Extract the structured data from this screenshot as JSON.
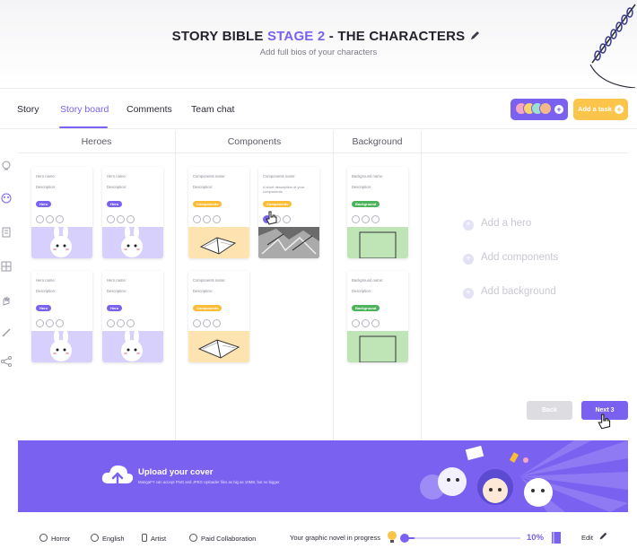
{
  "header": {
    "title_prefix": "STORY BIBLE ",
    "title_stage": "STAGE 2",
    "title_suffix": " - THE CHARACTERS",
    "subtitle": "Add full bios of your characters"
  },
  "tabs": [
    {
      "label": "Story"
    },
    {
      "label": "Story board",
      "active": true
    },
    {
      "label": "Comments"
    },
    {
      "label": "Team chat"
    }
  ],
  "actions": {
    "add_task": "Add a task"
  },
  "columns": {
    "heroes": "Heroes",
    "components": "Components",
    "background": "Background"
  },
  "cards": {
    "hero": {
      "name_label": "Hero name:",
      "desc_label": "Description:",
      "tag": "Hero"
    },
    "component": {
      "name_label": "Components name:",
      "desc_label": "Description:",
      "tag": "Components"
    },
    "component_filled": {
      "name_label": "Components name:",
      "desc_text": "A short description of your components",
      "tag": "Components"
    },
    "component_lower": {
      "name_label": "Components name:",
      "desc_label": "Description:",
      "tag": "Components"
    },
    "background": {
      "name_label": "Background name:",
      "desc_label": "Description:",
      "tag": "Background"
    }
  },
  "add_links": {
    "hero": "Add a hero",
    "components": "Add components",
    "background": "Add background"
  },
  "buttons": {
    "back": "Back",
    "next": "Next 3"
  },
  "banner": {
    "title": "Upload your cover",
    "subtitle": "MangaFY can accept PNG and JPEG Uploader files as big as 10MB, but no bigger."
  },
  "footer": {
    "genre": "Horror",
    "language": "English",
    "role": "Artist",
    "collab": "Paid Collaboration",
    "progress_label": "Your graphic novel in progress",
    "progress_pct": "10%",
    "progress_value": 0.1,
    "edit": "Edit"
  },
  "colors": {
    "accent": "#7b61f0",
    "hero_tag": "#7b61f0",
    "component_tag": "#fbbd36",
    "background_tag": "#4cb35a",
    "hero_thumb": "#d7cffc",
    "component_thumb": "#fde3b0",
    "background_thumb": "#bfe5b7"
  }
}
